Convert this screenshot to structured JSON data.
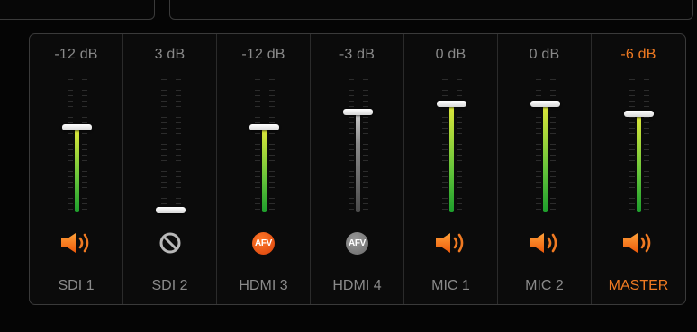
{
  "colors": {
    "accent": "#f07a22",
    "label": "#8a8a8a",
    "meter_green": "#64c43a",
    "meter_gray": "#8a8a8a"
  },
  "channels": [
    {
      "name": "SDI 1",
      "level": "-12 dB",
      "fader_position": 0.64,
      "fill": "green",
      "status": "audio-on",
      "status_icon": "speaker-icon",
      "accent": false
    },
    {
      "name": "SDI 2",
      "level": "3 dB",
      "fader_position": 0.02,
      "fill": "none",
      "status": "disabled",
      "status_icon": "prohibited-icon",
      "accent": false
    },
    {
      "name": "HDMI 3",
      "level": "-12 dB",
      "fader_position": 0.64,
      "fill": "green",
      "status": "afv-on",
      "status_icon": "afv-icon",
      "status_text": "AFV",
      "accent": false
    },
    {
      "name": "HDMI 4",
      "level": "-3 dB",
      "fader_position": 0.76,
      "fill": "gray",
      "status": "afv-off",
      "status_icon": "afv-icon",
      "status_text": "AFV",
      "accent": false
    },
    {
      "name": "MIC 1",
      "level": "0 dB",
      "fader_position": 0.82,
      "fill": "green",
      "status": "audio-on",
      "status_icon": "speaker-icon",
      "accent": false
    },
    {
      "name": "MIC 2",
      "level": "0 dB",
      "fader_position": 0.82,
      "fill": "green",
      "status": "audio-on",
      "status_icon": "speaker-icon",
      "accent": false
    },
    {
      "name": "MASTER",
      "level": "-6 dB",
      "fader_position": 0.74,
      "fill": "green",
      "status": "audio-on",
      "status_icon": "speaker-icon",
      "accent": true
    }
  ]
}
